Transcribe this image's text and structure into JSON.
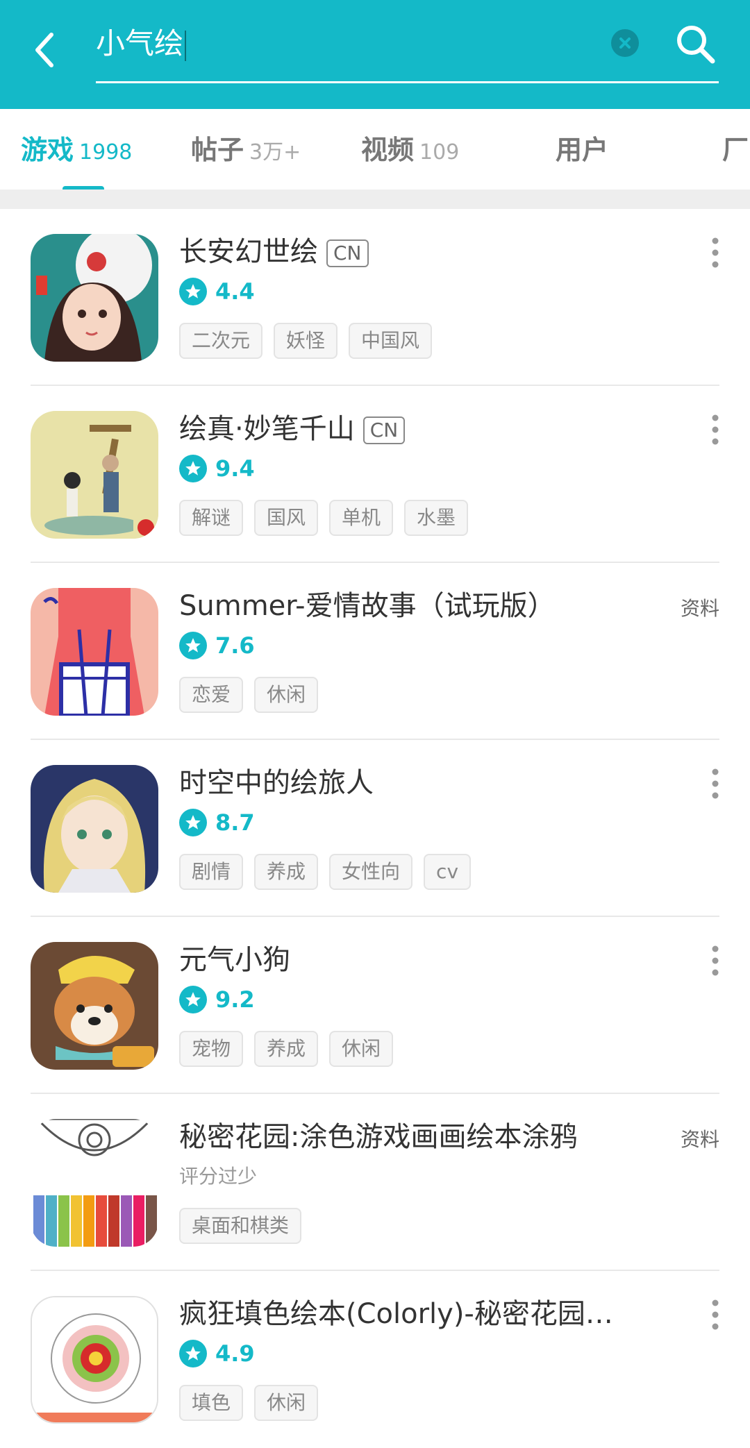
{
  "search": {
    "query": "小气绘",
    "back_icon": "chevron-left-icon",
    "clear_icon": "close-icon",
    "search_icon": "search-icon"
  },
  "tabs": [
    {
      "label": "游戏",
      "count": "1998",
      "active": true
    },
    {
      "label": "帖子",
      "count": "3万+",
      "active": false
    },
    {
      "label": "视频",
      "count": "109",
      "active": false
    },
    {
      "label": "用户",
      "count": "",
      "active": false
    },
    {
      "label": "厂",
      "count": "",
      "active": false
    }
  ],
  "colors": {
    "accent": "#14b9c8"
  },
  "games": [
    {
      "title": "长安幻世绘",
      "badge": "CN",
      "rating": "4.4",
      "tags": [
        "二次元",
        "妖怪",
        "中国风"
      ],
      "action": "more"
    },
    {
      "title": "绘真·妙笔千山",
      "badge": "CN",
      "rating": "9.4",
      "tags": [
        "解谜",
        "国风",
        "单机",
        "水墨"
      ],
      "action": "more"
    },
    {
      "title": "Summer-爱情故事（试玩版）",
      "badge": "",
      "rating": "7.6",
      "tags": [
        "恋爱",
        "休闲"
      ],
      "action": "资料"
    },
    {
      "title": "时空中的绘旅人",
      "badge": "",
      "rating": "8.7",
      "tags": [
        "剧情",
        "养成",
        "女性向",
        "cv"
      ],
      "action": "more"
    },
    {
      "title": "元气小狗",
      "badge": "",
      "rating": "9.2",
      "tags": [
        "宠物",
        "养成",
        "休闲"
      ],
      "action": "more"
    },
    {
      "title": "秘密花园:涂色游戏画画绘本涂鸦",
      "badge": "",
      "rating": "",
      "rating_text": "评分过少",
      "tags": [
        "桌面和棋类"
      ],
      "action": "资料"
    },
    {
      "title": "疯狂填色绘本(Colorly)-秘密花园着...",
      "badge": "",
      "rating": "4.9",
      "tags": [
        "填色",
        "休闲"
      ],
      "action": "more"
    }
  ]
}
